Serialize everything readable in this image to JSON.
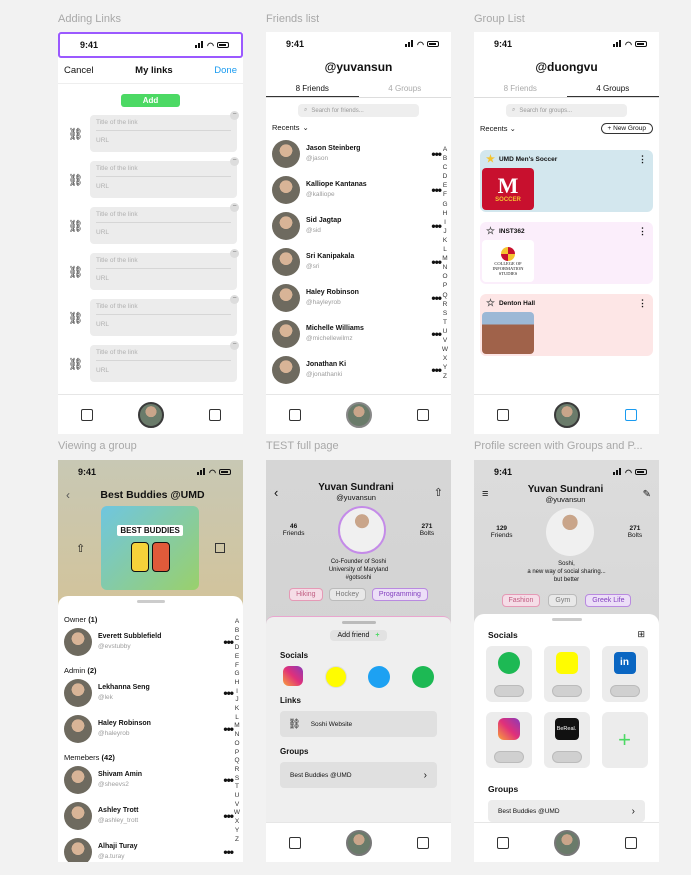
{
  "frames": {
    "adding_links": "Adding Links",
    "friends_list": "Friends list",
    "group_list": "Group List",
    "viewing_group": "Viewing a group",
    "test_full_page": "TEST full page",
    "profile_screen": "Profile screen with Groups and P..."
  },
  "time": "9:41",
  "links_screen": {
    "cancel": "Cancel",
    "title": "My links",
    "done": "Done",
    "add": "Add",
    "title_placeholder": "Title of the link",
    "url_placeholder": "URL",
    "count": 6
  },
  "friends_screen": {
    "username": "@yuvansun",
    "tab_friends": "8 Friends",
    "tab_groups": "4 Groups",
    "search_placeholder": "Search for friends...",
    "recents": "Recents",
    "friends": [
      {
        "name": "Jason Steinberg",
        "handle": "@jason"
      },
      {
        "name": "Kalliope Kantanas",
        "handle": "@kalliope"
      },
      {
        "name": "Sid Jagtap",
        "handle": "@sid"
      },
      {
        "name": "Sri Kanipakala",
        "handle": "@sri"
      },
      {
        "name": "Haley Robinson",
        "handle": "@hayleyrob"
      },
      {
        "name": "Michelle Williams",
        "handle": "@michellewilmz"
      },
      {
        "name": "Jonathan Ki",
        "handle": "@jonathanki"
      }
    ],
    "alphabet": [
      "A",
      "B",
      "C",
      "D",
      "E",
      "F",
      "G",
      "H",
      "I",
      "J",
      "K",
      "L",
      "M",
      "N",
      "O",
      "P",
      "Q",
      "R",
      "S",
      "T",
      "U",
      "V",
      "W",
      "X",
      "Y",
      "Z"
    ]
  },
  "groups_screen": {
    "username": "@duongvu",
    "tab_friends": "8 Friends",
    "tab_groups": "4 Groups",
    "search_placeholder": "Search for groups...",
    "recents": "Recents",
    "new_group": "New Group",
    "groups": [
      {
        "name": "UMD Men's Soccer",
        "color": "#d3e7ee",
        "logo_text": "M",
        "logo_sub": "SOCCER"
      },
      {
        "name": "INST362",
        "color": "#fbeefb",
        "logo_text": "COLLEGE OF INFORMATION STUDIES",
        "logo_sub": ""
      },
      {
        "name": "Denton Hall",
        "color": "#fde6e6",
        "logo_text": "",
        "logo_sub": ""
      }
    ]
  },
  "viewing_group": {
    "title": "Best Buddies @UMD",
    "banner_text": "BEST BUDDIES",
    "owner_label": "Owner",
    "owner_count": "(1)",
    "admin_label": "Admin",
    "admin_count": "(2)",
    "members_label": "Memebers",
    "members_count": "(42)",
    "owner": [
      {
        "name": "Everett Subblefield",
        "handle": "@evstubby"
      }
    ],
    "admins": [
      {
        "name": "Lekhanna Seng",
        "handle": "@lek"
      },
      {
        "name": "Haley Robinson",
        "handle": "@haleyrob"
      }
    ],
    "members": [
      {
        "name": "Shivam Amin",
        "handle": "@sheevs2"
      },
      {
        "name": "Ashley Trott",
        "handle": "@ashley_trott"
      },
      {
        "name": "Alhaji Turay",
        "handle": "@a.turay"
      }
    ]
  },
  "test_full": {
    "name": "Yuvan Sundrani",
    "handle": "@yuvansun",
    "friends_count": "46",
    "friends_label": "Friends",
    "bolts_count": "271",
    "bolts_label": "Bolts",
    "bio_1": "Co-Founder of Soshi",
    "bio_2": "University of Maryland",
    "bio_3": "#gotsoshi",
    "tags": [
      "Hiking",
      "Hockey",
      "Programming"
    ],
    "add_friend": "Add friend",
    "socials_label": "Socials",
    "links_label": "Links",
    "link_name": "Soshi Website",
    "groups_label": "Groups",
    "group_name": "Best  Buddies @UMD"
  },
  "profile": {
    "name": "Yuvan Sundrani",
    "handle": "@yuvansun",
    "friends_count": "129",
    "friends_label": "Friends",
    "bolts_count": "271",
    "bolts_label": "Bolts",
    "bio_1": "Soshi,",
    "bio_2": "a new way of social sharing...",
    "bio_3": "but better",
    "tags": [
      "Fashion",
      "Gym",
      "Greek Life"
    ],
    "socials_label": "Socials",
    "groups_label": "Groups",
    "group_name": "Best Buddies @UMD",
    "bereal_label": "BeReal."
  },
  "colors": {
    "accent_blue": "#1a9bf0",
    "add_green": "#4cd964",
    "selection_purple": "#9b59ff"
  }
}
